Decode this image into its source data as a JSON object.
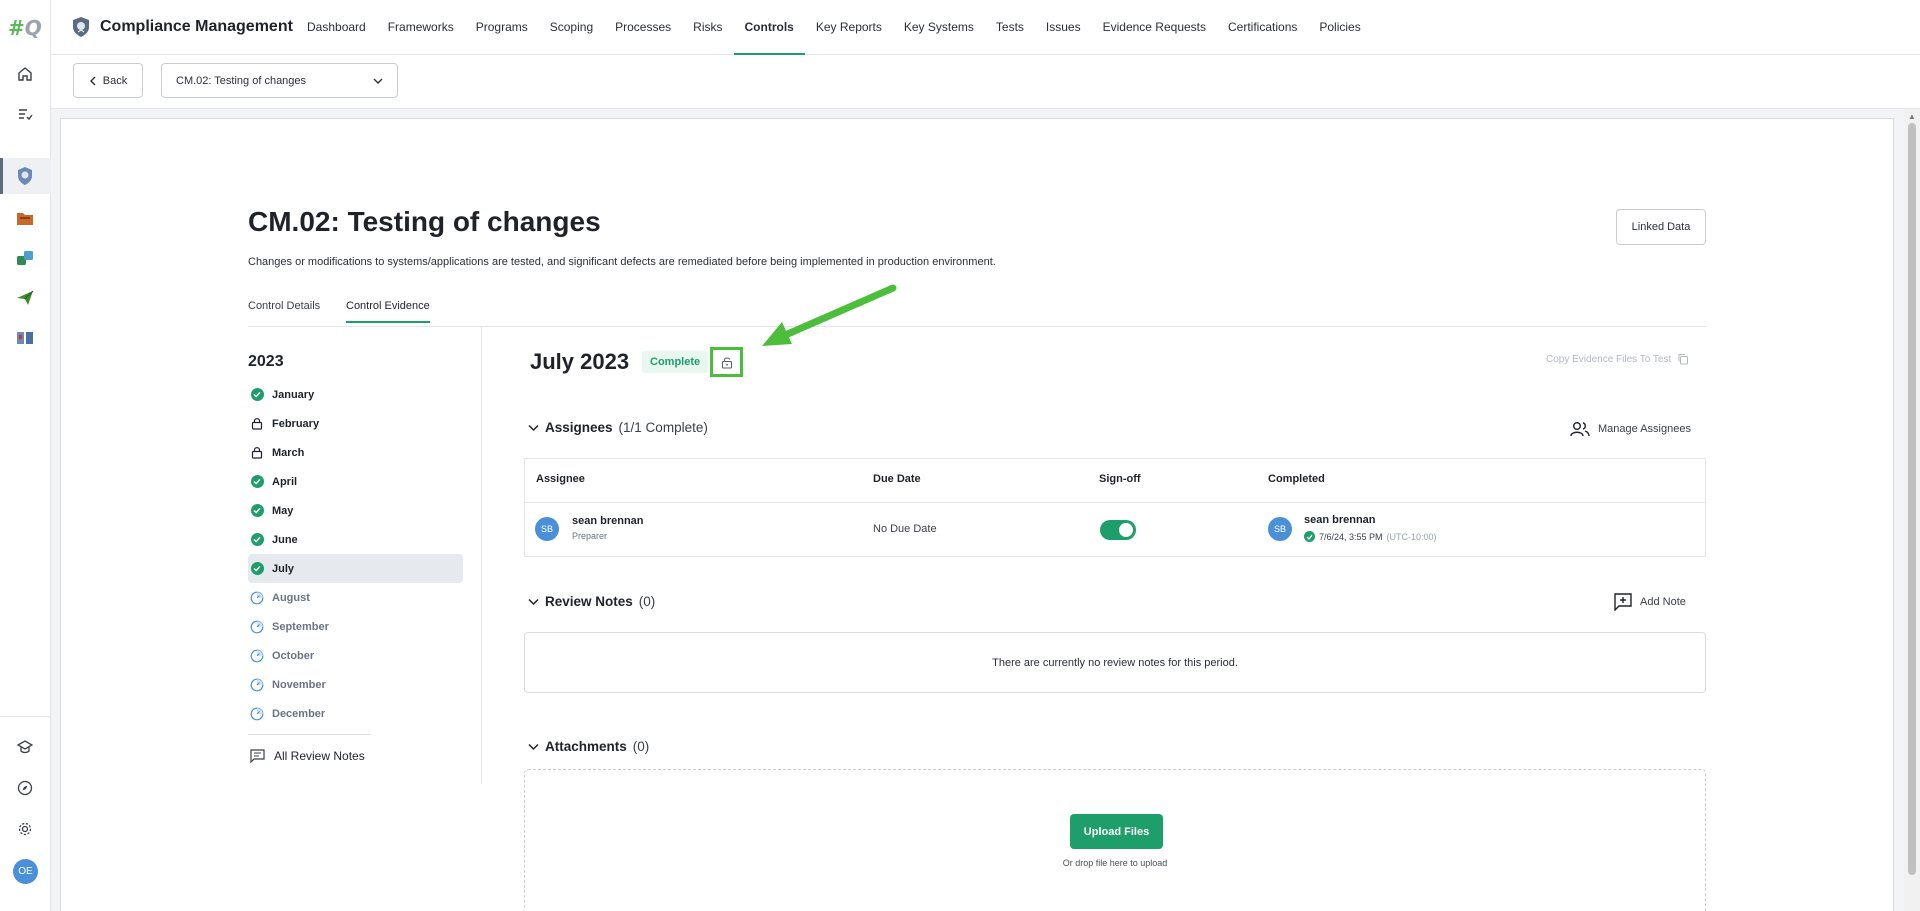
{
  "app": {
    "title": "Compliance Management",
    "logo_hash": "#",
    "logo_letter": "Q",
    "user_initials": "OE"
  },
  "nav": {
    "items": [
      {
        "label": "Dashboard",
        "active": false
      },
      {
        "label": "Frameworks",
        "active": false
      },
      {
        "label": "Programs",
        "active": false
      },
      {
        "label": "Scoping",
        "active": false
      },
      {
        "label": "Processes",
        "active": false
      },
      {
        "label": "Risks",
        "active": false
      },
      {
        "label": "Controls",
        "active": true
      },
      {
        "label": "Key Reports",
        "active": false
      },
      {
        "label": "Key Systems",
        "active": false
      },
      {
        "label": "Tests",
        "active": false
      },
      {
        "label": "Issues",
        "active": false
      },
      {
        "label": "Evidence Requests",
        "active": false
      },
      {
        "label": "Certifications",
        "active": false
      },
      {
        "label": "Policies",
        "active": false
      }
    ]
  },
  "subbar": {
    "back_label": "Back",
    "control_select": "CM.02: Testing of changes"
  },
  "page": {
    "title": "CM.02: Testing of changes",
    "description": "Changes or modifications to systems/applications are tested, and significant defects are remediated before being implemented in production environment.",
    "linked_data_label": "Linked Data",
    "tabs": [
      {
        "label": "Control Details",
        "active": false
      },
      {
        "label": "Control Evidence",
        "active": true
      }
    ]
  },
  "periods": {
    "year": "2023",
    "months": [
      {
        "label": "January",
        "status": "complete"
      },
      {
        "label": "February",
        "status": "locked"
      },
      {
        "label": "March",
        "status": "locked"
      },
      {
        "label": "April",
        "status": "complete"
      },
      {
        "label": "May",
        "status": "complete"
      },
      {
        "label": "June",
        "status": "complete"
      },
      {
        "label": "July",
        "status": "complete",
        "selected": true
      },
      {
        "label": "August",
        "status": "pending"
      },
      {
        "label": "September",
        "status": "pending"
      },
      {
        "label": "October",
        "status": "pending"
      },
      {
        "label": "November",
        "status": "pending"
      },
      {
        "label": "December",
        "status": "pending"
      }
    ],
    "all_review_notes_label": "All Review Notes"
  },
  "evidence": {
    "period_title": "July 2023",
    "status_badge": "Complete",
    "copy_link": "Copy Evidence Files To Test",
    "assignees": {
      "title": "Assignees",
      "count": "(1/1 Complete)",
      "manage_label": "Manage Assignees",
      "columns": [
        "Assignee",
        "Due Date",
        "Sign-off",
        "Completed"
      ],
      "rows": [
        {
          "initials": "SB",
          "name": "sean brennan",
          "role": "Preparer",
          "due_date": "No Due Date",
          "signoff": true,
          "completed_by": "sean brennan",
          "completed_initials": "SB",
          "completed_at": "7/6/24, 3:55 PM",
          "completed_tz": "(UTC-10:00)"
        }
      ]
    },
    "review_notes": {
      "title": "Review Notes",
      "count": "(0)",
      "add_label": "Add Note",
      "empty_text": "There are currently no review notes for this period."
    },
    "attachments": {
      "title": "Attachments",
      "count": "(0)",
      "upload_label": "Upload Files",
      "drop_text": "Or drop file here to upload"
    }
  },
  "colors": {
    "accent_green": "#1e9e6a",
    "highlight_green": "#4cbe3b",
    "avatar_blue": "#4a90d9"
  }
}
